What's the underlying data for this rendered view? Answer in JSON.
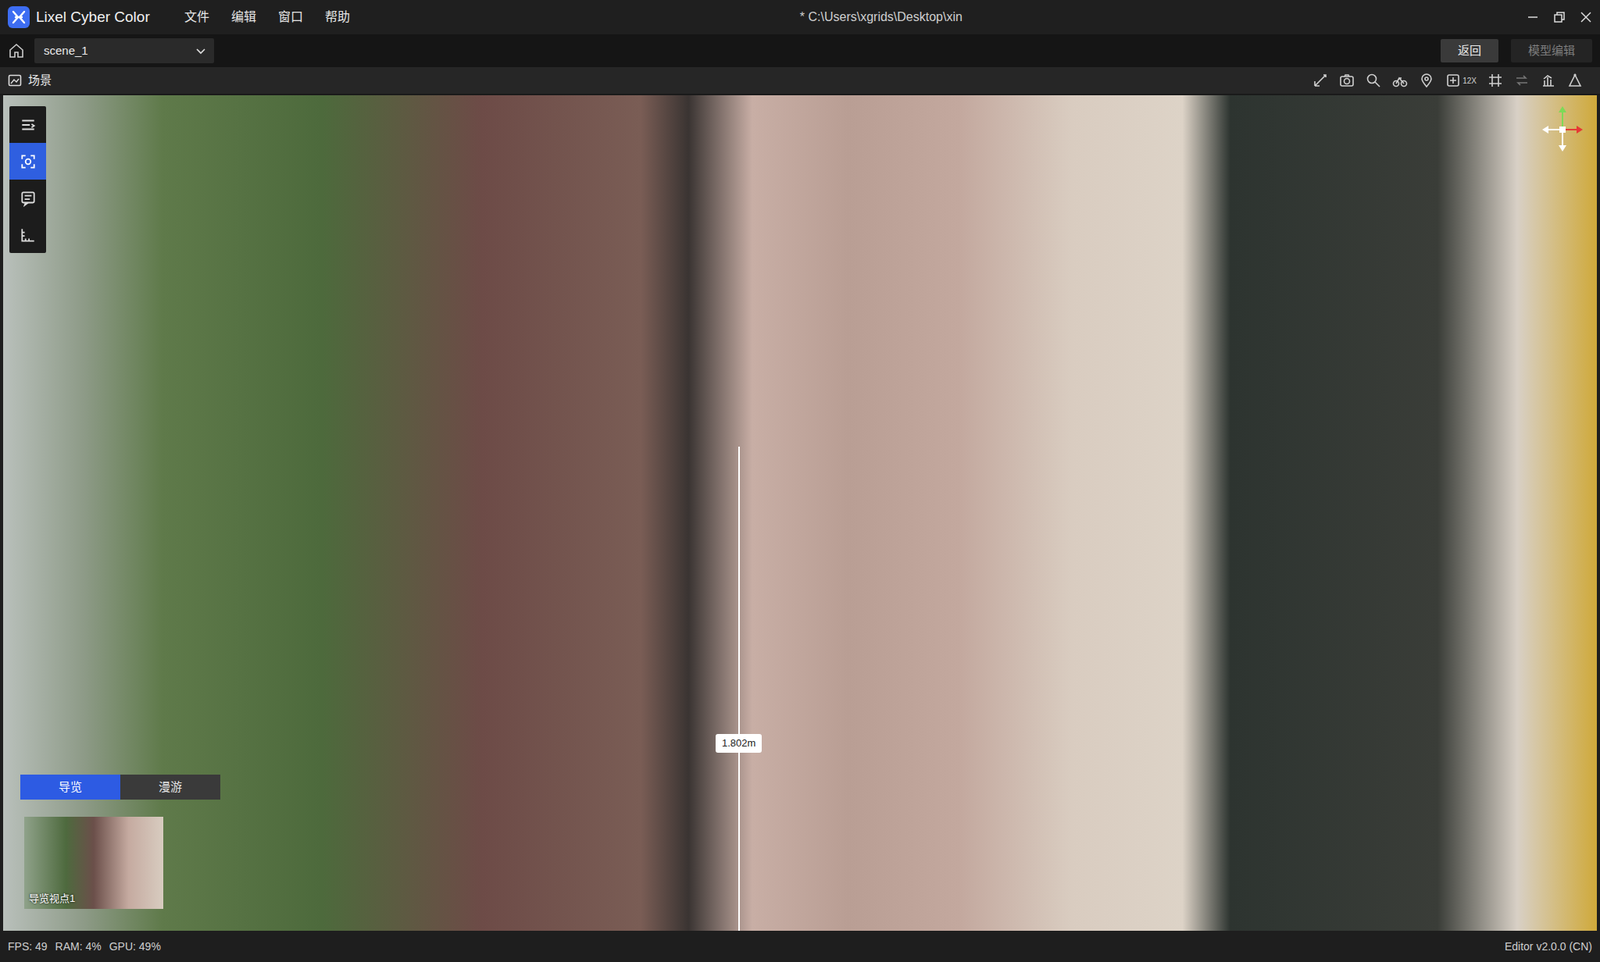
{
  "window": {
    "app_name": "Lixel Cyber Color",
    "title": "* C:\\Users\\xgrids\\Desktop\\xin"
  },
  "menu": [
    "文件",
    "编辑",
    "窗口",
    "帮助"
  ],
  "scene_select": {
    "value": "scene_1"
  },
  "header_buttons": [
    {
      "label": "返回",
      "disabled": false
    },
    {
      "label": "模型编辑",
      "disabled": true
    }
  ],
  "panel": {
    "title": "场景"
  },
  "toolbar_badge": "12X",
  "left_tools": [
    {
      "selected": false
    },
    {
      "selected": true
    },
    {
      "selected": false
    },
    {
      "selected": false
    }
  ],
  "measurement": {
    "reading": "1.802m"
  },
  "view_modes": [
    {
      "label": "导览",
      "selected": true
    },
    {
      "label": "漫游",
      "selected": false
    }
  ],
  "viewpoints": [
    {
      "label": "导览视点1"
    }
  ],
  "status_bar": {
    "fps": "FPS: 49",
    "ram": "RAM: 4%",
    "gpu": "GPU: 49%",
    "version": "Editor v2.0.0 (CN)"
  }
}
